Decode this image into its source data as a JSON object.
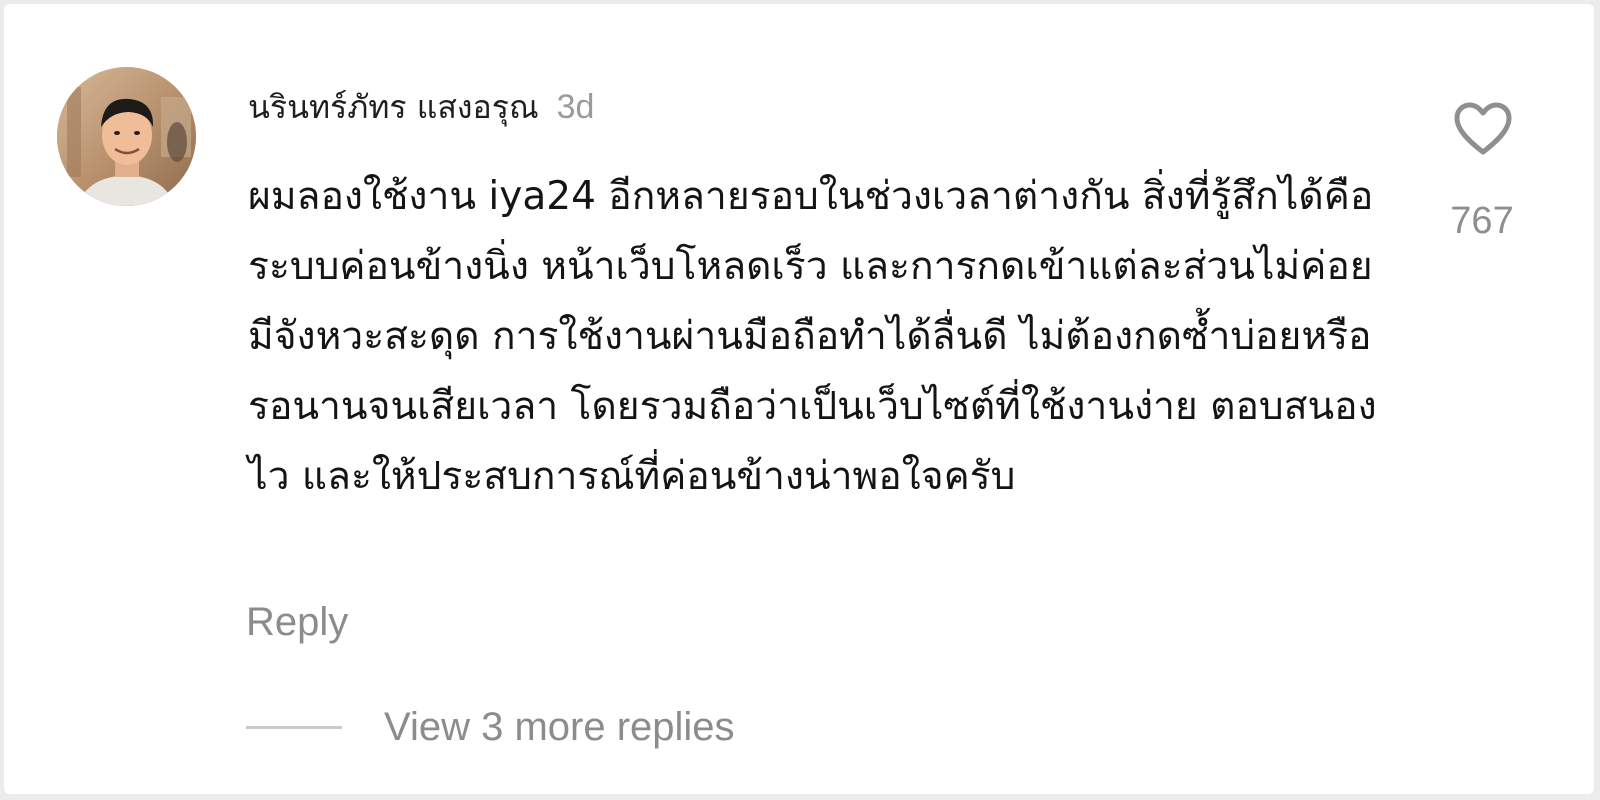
{
  "comment": {
    "author": "นรินทร์ภัทร แสงอรุณ",
    "time_ago": "3d",
    "text": "ผมลองใช้งาน iya24 อีกหลายรอบในช่วงเวลาต่างกัน สิ่งที่รู้สึกได้คือระบบค่อนข้างนิ่ง หน้าเว็บโหลดเร็ว และการกดเข้าแต่ละส่วนไม่ค่อยมีจังหวะสะดุด การใช้งานผ่านมือถือทำได้ลื่นดี ไม่ต้องกดซ้ำบ่อยหรือรอนานจนเสียเวลา โดยรวมถือว่าเป็นเว็บไซต์ที่ใช้งานง่าย ตอบสนองไว และให้ประสบการณ์ที่ค่อนข้างน่าพอใจครับ",
    "like_count": "767",
    "like_icon": "heart-outline-icon",
    "reply_label": "Reply",
    "view_replies_label": "View 3 more replies"
  },
  "colors": {
    "text_primary": "#141414",
    "text_secondary": "#8c8c8c",
    "background": "#ffffff"
  }
}
